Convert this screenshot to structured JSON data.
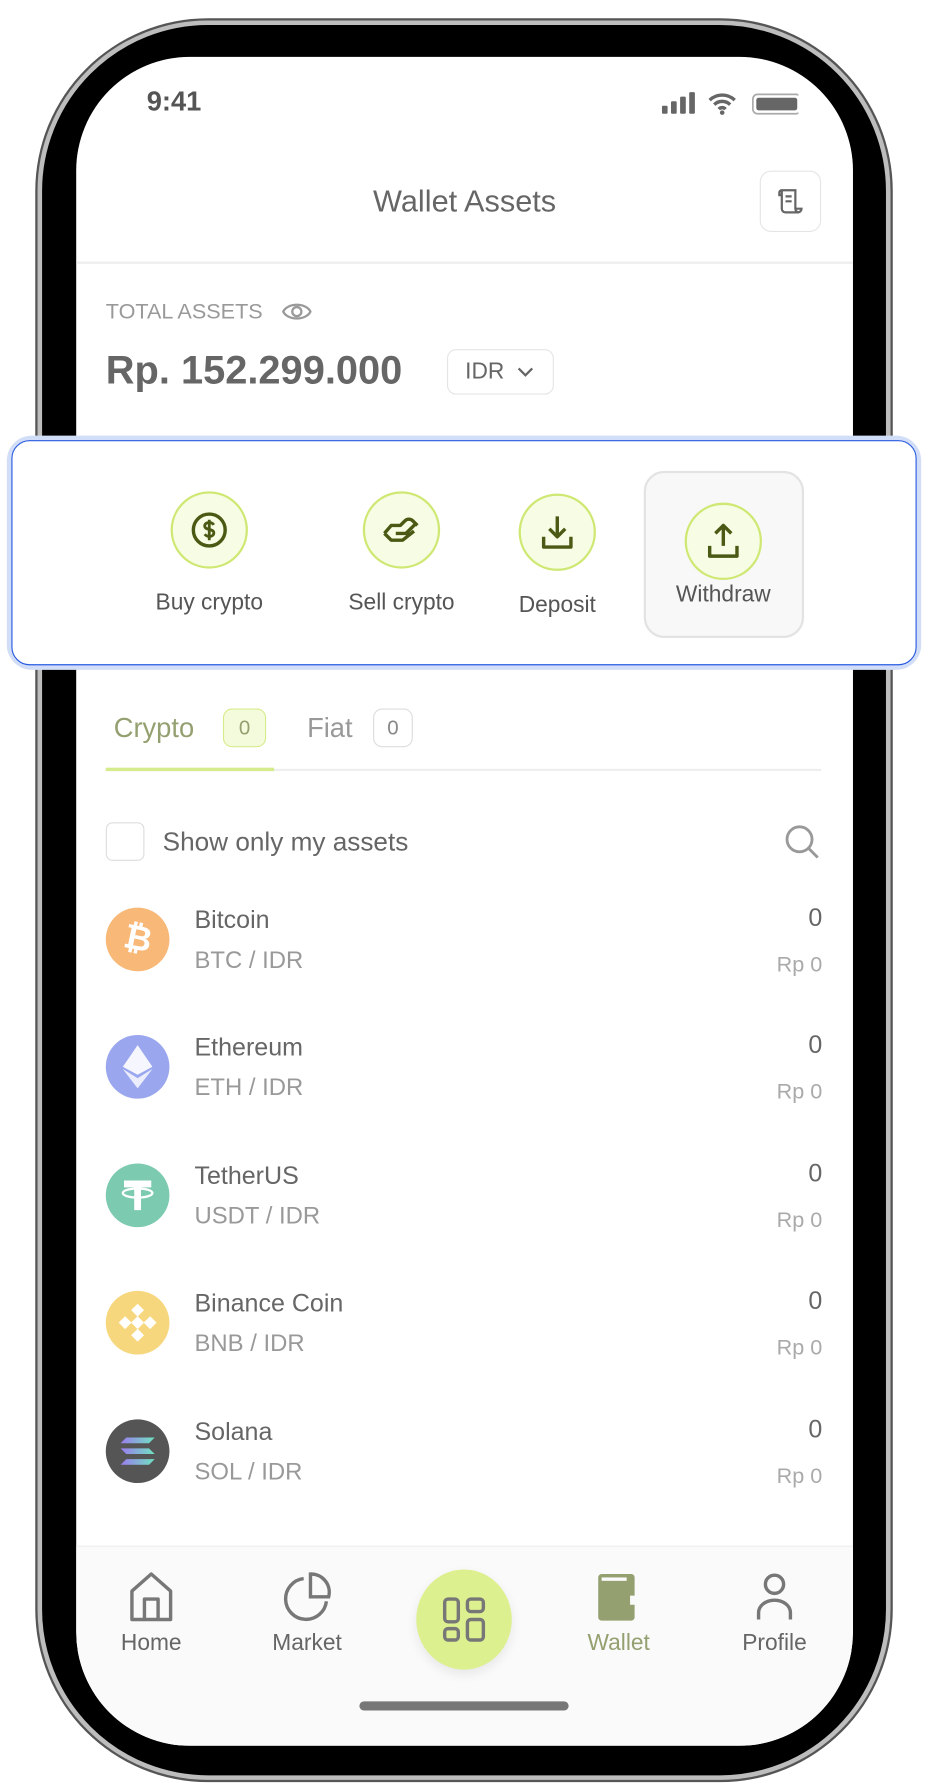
{
  "status_bar": {
    "time": "9:41"
  },
  "header": {
    "title": "Wallet Assets",
    "receipt_icon": "receipt-icon"
  },
  "total": {
    "label": "TOTAL ASSETS",
    "amount": "Rp. 152.299.000",
    "currency": "IDR"
  },
  "actions": [
    {
      "label": "Buy crypto",
      "icon": "dollar-circle-icon"
    },
    {
      "label": "Sell crypto",
      "icon": "hand-icon"
    },
    {
      "label": "Deposit",
      "icon": "download-icon"
    },
    {
      "label": "Withdraw",
      "icon": "upload-icon"
    }
  ],
  "tabs": [
    {
      "label": "Crypto",
      "count": "0",
      "active": true
    },
    {
      "label": "Fiat",
      "count": "0"
    }
  ],
  "filter": {
    "label": "Show only my assets",
    "checked": false
  },
  "assets": [
    {
      "name": "Bitcoin",
      "pair": "BTC / IDR",
      "amount": "0",
      "value": "Rp 0",
      "color": "#f7b878"
    },
    {
      "name": "Ethereum",
      "pair": "ETH / IDR",
      "amount": "0",
      "value": "Rp 0",
      "color": "#9aa7ee"
    },
    {
      "name": "TetherUS",
      "pair": "USDT / IDR",
      "amount": "0",
      "value": "Rp 0",
      "color": "#7ccab0"
    },
    {
      "name": "Binance Coin",
      "pair": "BNB / IDR",
      "amount": "0",
      "value": "Rp 0",
      "color": "#f7d77e"
    },
    {
      "name": "Solana",
      "pair": "SOL / IDR",
      "amount": "0",
      "value": "Rp 0",
      "color": "#555555"
    }
  ],
  "nav": [
    {
      "label": "Home"
    },
    {
      "label": "Market"
    },
    {
      "label": ""
    },
    {
      "label": "Wallet",
      "active": true
    },
    {
      "label": "Profile"
    }
  ],
  "colors": {
    "accent": "#94a070",
    "highlight": "#2a5be0",
    "center_button": "#ddf08f"
  }
}
